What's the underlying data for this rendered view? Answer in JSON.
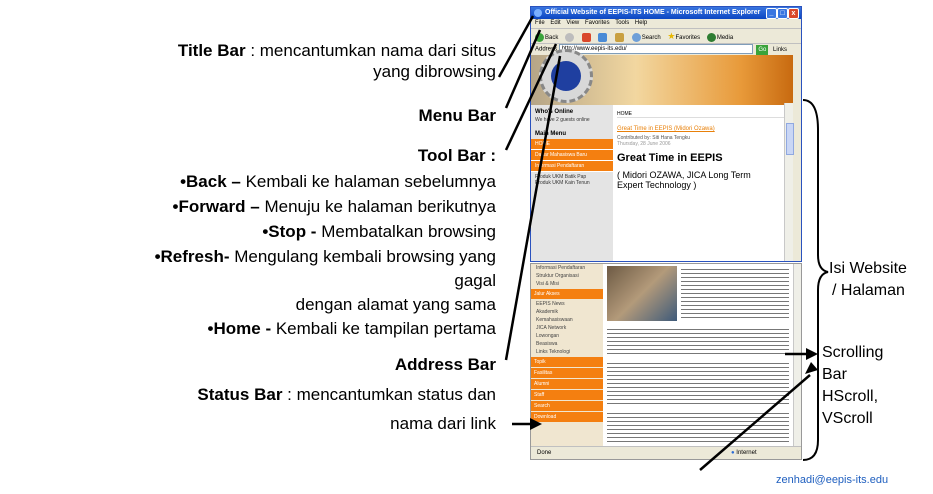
{
  "annotations": {
    "title_bar": {
      "term": "Title Bar",
      "desc_1": " : mencantumkan nama dari situs",
      "desc_2": "yang dibrowsing"
    },
    "menu_bar": "Menu Bar",
    "tool_bar": "Tool Bar :",
    "back": {
      "term": "•Back –",
      "desc": " Kembali ke halaman sebelumnya"
    },
    "forward": {
      "term": "•Forward –",
      "desc": " Menuju ke halaman berikutnya"
    },
    "stop": {
      "term": "•Stop -",
      "desc": " Membatalkan browsing"
    },
    "refresh": {
      "term": "•Refresh-",
      "desc_1": " Mengulang kembali browsing yang",
      "desc_2": "gagal",
      "desc_3": "dengan alamat yang sama"
    },
    "home": {
      "term": "•Home -",
      "desc": " Kembali ke tampilan pertama"
    },
    "address_bar": "Address Bar",
    "status_bar": {
      "term": "Status Bar",
      "desc_1": " : mencantumkan status dan",
      "desc_2": "nama dari link"
    },
    "isi_website_1": "Isi Website",
    "isi_website_2": "/ Halaman",
    "scrolling_1": "Scrolling",
    "scrolling_2": "Bar",
    "scrolling_3": "HScroll,",
    "scrolling_4": "VScroll",
    "email": "zenhadi@eepis-its.edu"
  },
  "browser": {
    "title": "Official Website of EEPIS-ITS   HOME - Microsoft Internet Explorer",
    "menu": [
      "File",
      "Edit",
      "View",
      "Favorites",
      "Tools",
      "Help"
    ],
    "toolbar": [
      "Back",
      "Search",
      "Favorites",
      "Media"
    ],
    "address_label": "Address",
    "address_value": "http://www.eepis-its.edu/",
    "go": "Go",
    "links": "Links",
    "whos_online": "Who's Online",
    "whos_online_text": "We have 2 guests online",
    "main_menu": "Main Menu",
    "menu_items": [
      "HOME",
      "Daftar Mahasiswa Baru",
      "Informasi Pendaftaran"
    ],
    "side_links": [
      "Produk UKM Batik Pap",
      "Produk UKM Kain Tenun"
    ],
    "breadcrumb": "HOME",
    "article_link": "Great Time in EEPIS (Midori Ozawa)",
    "contributed": "Contributed by: Siti Hana Tengku",
    "date": "Thursday, 28 June 2006",
    "headline": "Great Time in EEPIS",
    "subhead": "( Midori OZAWA, JICA Long Term Expert Technology )",
    "status_left": "Done",
    "status_right": "Internet"
  },
  "page2": {
    "left_items": [
      "Informasi Pendaftaran",
      "Struktur Organisasi",
      "Visi & Misi"
    ],
    "left_orange": [
      "Jalur Akses",
      "Topik",
      "Fasilitas",
      "Alumni",
      "Staff",
      "Search",
      "Download"
    ],
    "left_sub": [
      "EEPIS News",
      "Akademik",
      "Kemahasiswaan",
      "JICA Network",
      "Lowongan",
      "Beasiswa",
      "Links Teknologi"
    ]
  }
}
